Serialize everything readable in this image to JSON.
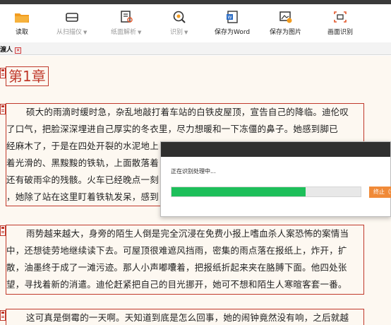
{
  "toolbar": {
    "read": "读取",
    "scan": "从扫描仪",
    "parse": "纸面解析",
    "recognize": "识别",
    "save_word": "保存为Word",
    "save_image": "保存为图片",
    "screen_ocr": "画面识别"
  },
  "tab": {
    "label": "渡人",
    "close": "×"
  },
  "document": {
    "chapter_title": "第1章",
    "paragraph1": [
      "硕大的雨滴时缓时急，杂乱地敲打着车站的白铁皮屋顶，宣告自己的降临。迪伦叹",
      "了口气，把脸深深埋进自己厚实的冬衣里，尽力想暖和一下冻僵的鼻子。她感到脚已",
      "经麻木了，于是在四处开裂的水泥地上",
      "着光滑的、黑黢黢的铁轨，上面散落着",
      "还有破雨伞的残骸。火车已经晚点一刻",
      "，她除了站在这里盯着铁轨发呆，感到"
    ],
    "paragraph2": [
      "雨势越来越大，身旁的陌生人倒是完全沉浸在免费小报上嗜血杀人案恐怖的案情当",
      "中，还想徒劳地继续读下去。可屋顶很难遮风挡雨，密集的雨点落在报纸上，炸开，扩",
      "散，油墨终于成了一滩污迹。那人小声嘟囔着，把报纸折起来夹在胳膊下面。他四处张",
      "望，寻找着新的消遣。迪伦赶紧把自己的目光挪开，她可不想和陌生人寒暄客套一番。"
    ],
    "paragraph3": [
      "这可真是倒霉的一天啊。天知道到底是怎么回事，她的闹钟竟然没有响，之后就越"
    ]
  },
  "dialog": {
    "message": "正在识别处理中...",
    "progress": 0.71,
    "stop_label": "终止（S）"
  },
  "colors": {
    "accent_red": "#c0392b",
    "progress_green": "#1dbf5a",
    "stop_orange": "#f08a38",
    "doc_background": "#fdf8f1"
  }
}
